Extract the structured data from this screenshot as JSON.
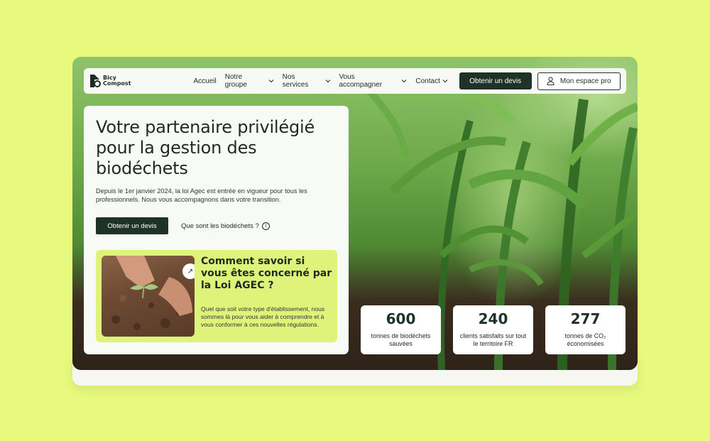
{
  "brand": {
    "line1": "Bicy",
    "line2": "Compost"
  },
  "nav": {
    "items": [
      {
        "label": "Accueil",
        "dropdown": false
      },
      {
        "label": "Notre groupe",
        "dropdown": true
      },
      {
        "label": "Nos services",
        "dropdown": true
      },
      {
        "label": "Vous accompagner",
        "dropdown": true
      },
      {
        "label": "Contact",
        "dropdown": true
      }
    ],
    "cta_label": "Obtenir un devis",
    "pro_label": "Mon espace pro"
  },
  "hero": {
    "title": "Votre partenaire privilégié pour la gestion des biodéchets",
    "description": "Depuis le 1er janvier 2024, la loi Agec est entrée en vigueur pour tous les professionnels. Nous vous accompagnons dans votre transition.",
    "cta_label": "Obtenir un devis",
    "link_label": "Que sont les biodéchets ?"
  },
  "agec_card": {
    "title": "Comment savoir si vous êtes concerné par la Loi AGEC ?",
    "text": "Quel que soit votre type d'établissement, nous sommes là pour vous aider à comprendre et à vous conformer à ces nouvelles régulations."
  },
  "stats": [
    {
      "value": "600",
      "label": "tonnes de biodéchets sauvées"
    },
    {
      "value": "240",
      "label": "clients satisfaits sur tout le territoire FR"
    },
    {
      "value": "277",
      "label": "tonnes de CO₂ économisées"
    }
  ],
  "colors": {
    "page_bg": "#e7fa7e",
    "dark_green": "#1e3325",
    "lime": "#dff27a"
  }
}
